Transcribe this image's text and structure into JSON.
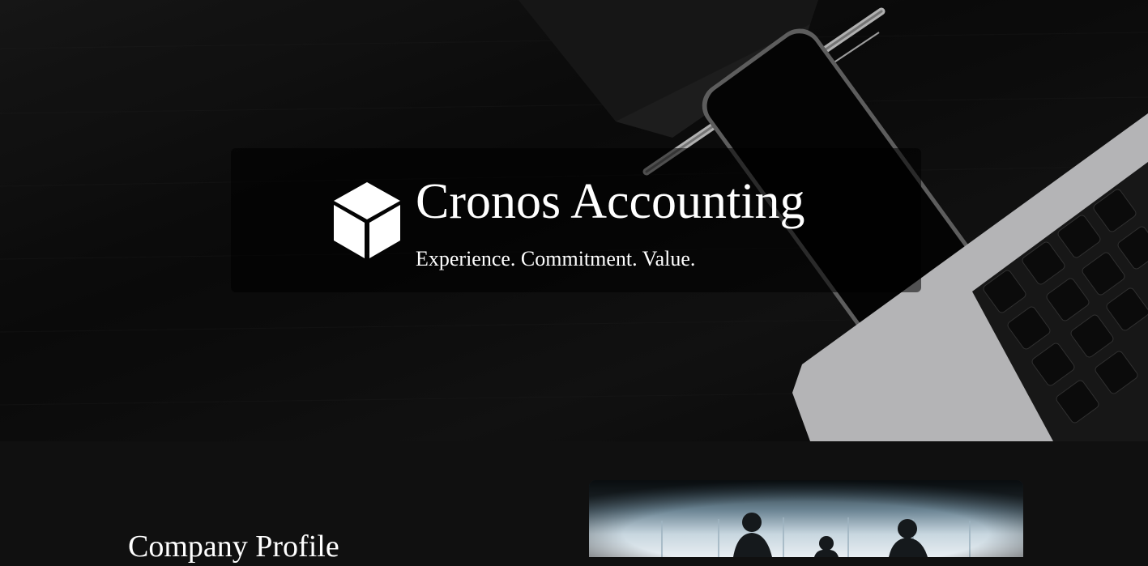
{
  "hero": {
    "logo_icon": "cube-icon",
    "title": "Cronos Accounting",
    "tagline": "Experience. Commitment. Value."
  },
  "profile": {
    "heading": "Company Profile"
  },
  "colors": {
    "page_background": "#101010",
    "text": "#ffffff",
    "banner_overlay": "rgba(0,0,0,0.55)"
  }
}
